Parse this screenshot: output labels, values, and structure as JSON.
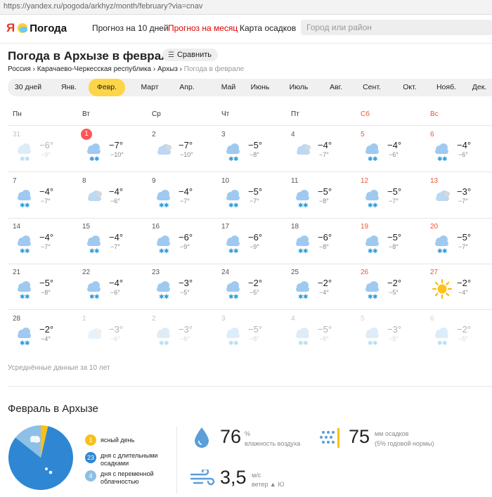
{
  "browser": {
    "url": "https://yandex.ru/pogoda/arkhyz/month/february?via=cnav"
  },
  "header": {
    "logo_ya": "Я",
    "logo_text": "Погода",
    "nav": [
      "Прогноз на 10 дней",
      "Прогноз на месяц",
      "Карта осадков"
    ],
    "search_placeholder": "Город или район"
  },
  "page": {
    "title": "Погода в Архызе в феврале",
    "compare_label": "Сравнить",
    "breadcrumbs": [
      "Россия",
      "Карачаево-Черкесская республика",
      "Архыз",
      "Погода в феврале"
    ],
    "avg_note": "Усреднённые данные за 10 лет"
  },
  "months": [
    "30 дней",
    "Янв.",
    "Февр.",
    "Март",
    "Апр.",
    "Май",
    "Июнь",
    "Июль",
    "Авг.",
    "Сент.",
    "Окт.",
    "Нояб.",
    "Дек."
  ],
  "active_month": 2,
  "weekdays": [
    "Пн",
    "Вт",
    "Ср",
    "Чт",
    "Пт",
    "Сб",
    "Вс"
  ],
  "weeks": [
    [
      {
        "d": "31",
        "hi": "−6°",
        "lo": "−9°",
        "icon": "snow",
        "faded": true
      },
      {
        "d": "1",
        "hi": "−7°",
        "lo": "−10°",
        "icon": "snow",
        "today": true
      },
      {
        "d": "2",
        "hi": "−7°",
        "lo": "−10°",
        "icon": "cloudy"
      },
      {
        "d": "3",
        "hi": "−5°",
        "lo": "−8°",
        "icon": "snow"
      },
      {
        "d": "4",
        "hi": "−4°",
        "lo": "−7°",
        "icon": "cloudy"
      },
      {
        "d": "5",
        "hi": "−4°",
        "lo": "−6°",
        "icon": "snow"
      },
      {
        "d": "6",
        "hi": "−4°",
        "lo": "−6°",
        "icon": "snow"
      }
    ],
    [
      {
        "d": "7",
        "hi": "−4°",
        "lo": "−7°",
        "icon": "snow"
      },
      {
        "d": "8",
        "hi": "−4°",
        "lo": "−6°",
        "icon": "cloudy"
      },
      {
        "d": "9",
        "hi": "−4°",
        "lo": "−7°",
        "icon": "snow"
      },
      {
        "d": "10",
        "hi": "−5°",
        "lo": "−7°",
        "icon": "snow"
      },
      {
        "d": "11",
        "hi": "−5°",
        "lo": "−8°",
        "icon": "snow"
      },
      {
        "d": "12",
        "hi": "−5°",
        "lo": "−7°",
        "icon": "snow"
      },
      {
        "d": "13",
        "hi": "−3°",
        "lo": "−7°",
        "icon": "cloudy"
      }
    ],
    [
      {
        "d": "14",
        "hi": "−4°",
        "lo": "−7°",
        "icon": "snow"
      },
      {
        "d": "15",
        "hi": "−4°",
        "lo": "−7°",
        "icon": "snow"
      },
      {
        "d": "16",
        "hi": "−6°",
        "lo": "−9°",
        "icon": "snow"
      },
      {
        "d": "17",
        "hi": "−6°",
        "lo": "−9°",
        "icon": "snow"
      },
      {
        "d": "18",
        "hi": "−6°",
        "lo": "−8°",
        "icon": "snow"
      },
      {
        "d": "19",
        "hi": "−5°",
        "lo": "−8°",
        "icon": "snow"
      },
      {
        "d": "20",
        "hi": "−5°",
        "lo": "−7°",
        "icon": "snow"
      }
    ],
    [
      {
        "d": "21",
        "hi": "−5°",
        "lo": "−8°",
        "icon": "snow"
      },
      {
        "d": "22",
        "hi": "−4°",
        "lo": "−6°",
        "icon": "snow"
      },
      {
        "d": "23",
        "hi": "−3°",
        "lo": "−5°",
        "icon": "snow"
      },
      {
        "d": "24",
        "hi": "−2°",
        "lo": "−5°",
        "icon": "snow"
      },
      {
        "d": "25",
        "hi": "−2°",
        "lo": "−4°",
        "icon": "snow"
      },
      {
        "d": "26",
        "hi": "−2°",
        "lo": "−5°",
        "icon": "snow"
      },
      {
        "d": "27",
        "hi": "−2°",
        "lo": "−4°",
        "icon": "sun"
      }
    ],
    [
      {
        "d": "28",
        "hi": "−2°",
        "lo": "−4°",
        "icon": "snow"
      },
      {
        "d": "1",
        "hi": "−3°",
        "lo": "−6°",
        "icon": "cloudy",
        "faded": true
      },
      {
        "d": "2",
        "hi": "−3°",
        "lo": "−6°",
        "icon": "snow",
        "faded": true
      },
      {
        "d": "3",
        "hi": "−5°",
        "lo": "−8°",
        "icon": "snow",
        "faded": true
      },
      {
        "d": "4",
        "hi": "−5°",
        "lo": "−8°",
        "icon": "snow",
        "faded": true
      },
      {
        "d": "5",
        "hi": "−3°",
        "lo": "−5°",
        "icon": "snow",
        "faded": true
      },
      {
        "d": "6",
        "hi": "−2°",
        "lo": "−5°",
        "icon": "snow",
        "faded": true
      }
    ]
  ],
  "summary": {
    "title": "Февраль в Архызе",
    "legend": [
      {
        "count": "1",
        "label": "ясный день",
        "color": "#f7c11a"
      },
      {
        "count": "23",
        "label": "дня с длительными осадками",
        "color": "#2f86d3"
      },
      {
        "count": "4",
        "label": "дня с переменной облачностью",
        "color": "#8dc0e6"
      }
    ],
    "humidity": {
      "value": "76",
      "unit": "%",
      "label": "влажность воздуха"
    },
    "precip": {
      "value": "75",
      "unit": "мм осадков",
      "label": "(5% годовой нормы)"
    },
    "wind": {
      "value": "3,5",
      "unit": "м/с",
      "label": "ветер ▲ Ю"
    }
  },
  "colors": {
    "accent": "#fdd548",
    "weekend": "#e55533",
    "today": "#ff5555",
    "pie_rain": "#2f86d3",
    "pie_cloud": "#8dc0e6",
    "pie_sun": "#f7c11a"
  }
}
